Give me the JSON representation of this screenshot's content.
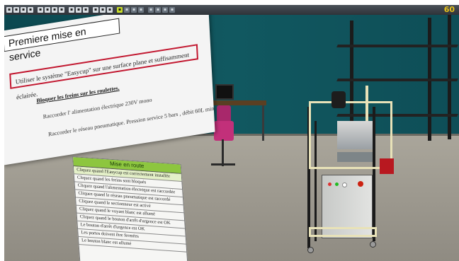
{
  "toolbar": {
    "fps": "60"
  },
  "instruction_panel": {
    "title": "Premiere mise en service",
    "highlighted_instruction": "Utiliser le système \"Easycup\" sur une surface plane et suffisamment éclairée.",
    "bold_instruction": "Bloquer les freins sur les roulettes.",
    "instruction_2": "Raccorder l' alimentation électrique 230V mono",
    "instruction_3": "Raccorder le réseau pneumatique. Pression service 5 bars , débit 60L min"
  },
  "checklist": {
    "header": "Mise en route",
    "items": [
      "Cliquez quand l'Easycup est correctement installée",
      "Cliquez quand les freins sont bloqués",
      "Cliquez quand l'alimentation électrique est raccordée",
      "Cliquez quand le réseau pneumatique est raccordé",
      "Cliquez quand le sectionneur est activé",
      "Cliquez quand le voyant blanc est allumé",
      "Cliquez quand le bouton d'arrêt d'urgence est OK",
      "Le bouton d'arrêt d'urgence est OK",
      "Les portes doivent être fermées",
      "Le bouton blanc est allumé"
    ]
  }
}
